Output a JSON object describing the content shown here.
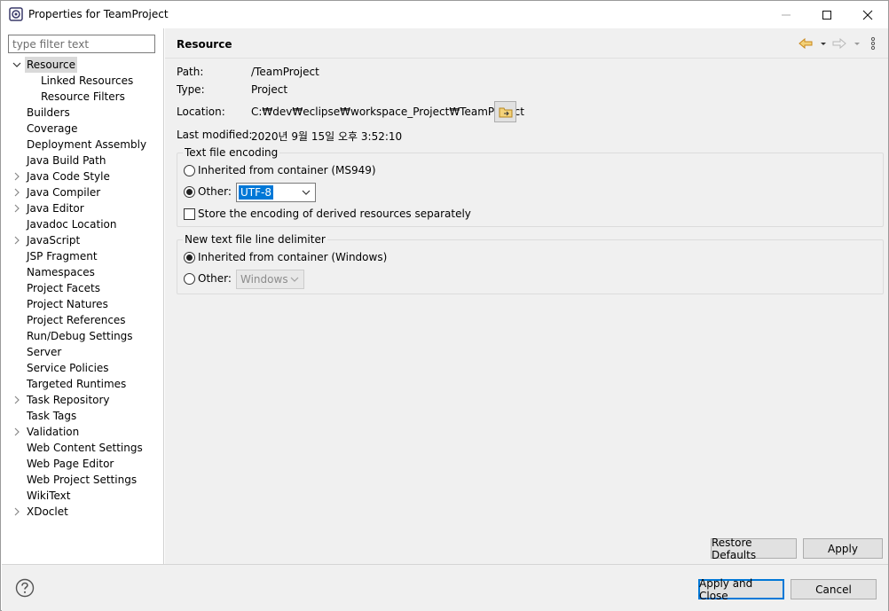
{
  "window": {
    "title": "Properties for TeamProject"
  },
  "filter": {
    "placeholder": "type filter text"
  },
  "tree": [
    {
      "label": "Resource",
      "level": 0,
      "expander": "expanded",
      "selected": true
    },
    {
      "label": "Linked Resources",
      "level": 1,
      "expander": "none"
    },
    {
      "label": "Resource Filters",
      "level": 1,
      "expander": "none"
    },
    {
      "label": "Builders",
      "level": 0,
      "expander": "none"
    },
    {
      "label": "Coverage",
      "level": 0,
      "expander": "none"
    },
    {
      "label": "Deployment Assembly",
      "level": 0,
      "expander": "none"
    },
    {
      "label": "Java Build Path",
      "level": 0,
      "expander": "none"
    },
    {
      "label": "Java Code Style",
      "level": 0,
      "expander": "collapsed"
    },
    {
      "label": "Java Compiler",
      "level": 0,
      "expander": "collapsed"
    },
    {
      "label": "Java Editor",
      "level": 0,
      "expander": "collapsed"
    },
    {
      "label": "Javadoc Location",
      "level": 0,
      "expander": "none"
    },
    {
      "label": "JavaScript",
      "level": 0,
      "expander": "collapsed"
    },
    {
      "label": "JSP Fragment",
      "level": 0,
      "expander": "none"
    },
    {
      "label": "Namespaces",
      "level": 0,
      "expander": "none"
    },
    {
      "label": "Project Facets",
      "level": 0,
      "expander": "none"
    },
    {
      "label": "Project Natures",
      "level": 0,
      "expander": "none"
    },
    {
      "label": "Project References",
      "level": 0,
      "expander": "none"
    },
    {
      "label": "Run/Debug Settings",
      "level": 0,
      "expander": "none"
    },
    {
      "label": "Server",
      "level": 0,
      "expander": "none"
    },
    {
      "label": "Service Policies",
      "level": 0,
      "expander": "none"
    },
    {
      "label": "Targeted Runtimes",
      "level": 0,
      "expander": "none"
    },
    {
      "label": "Task Repository",
      "level": 0,
      "expander": "collapsed"
    },
    {
      "label": "Task Tags",
      "level": 0,
      "expander": "none"
    },
    {
      "label": "Validation",
      "level": 0,
      "expander": "collapsed"
    },
    {
      "label": "Web Content Settings",
      "level": 0,
      "expander": "none"
    },
    {
      "label": "Web Page Editor",
      "level": 0,
      "expander": "none"
    },
    {
      "label": "Web Project Settings",
      "level": 0,
      "expander": "none"
    },
    {
      "label": "WikiText",
      "level": 0,
      "expander": "none"
    },
    {
      "label": "XDoclet",
      "level": 0,
      "expander": "collapsed"
    }
  ],
  "page": {
    "title": "Resource",
    "path_label": "Path:",
    "path_value": "/TeamProject",
    "type_label": "Type:",
    "type_value": "Project",
    "location_label": "Location:",
    "location_value": "C:₩dev₩eclipse₩workspace_Project₩TeamProject",
    "modified_label": "Last modified:",
    "modified_value": "2020년 9월 15일 오후 3:52:10"
  },
  "encoding": {
    "group_label": "Text file encoding",
    "inherited_label": "Inherited from container (MS949)",
    "other_label": "Other:",
    "other_value": "UTF-8",
    "store_label": "Store the encoding of derived resources separately"
  },
  "delimiter": {
    "group_label": "New text file line delimiter",
    "inherited_label": "Inherited from container (Windows)",
    "other_label": "Other:",
    "other_value": "Windows"
  },
  "buttons": {
    "restore_defaults": "Restore Defaults",
    "apply": "Apply",
    "apply_and_close": "Apply and Close",
    "cancel": "Cancel"
  },
  "icons": {
    "app": "eclipse-properties-icon",
    "back": "back-arrow-icon",
    "forward": "forward-arrow-icon",
    "menu": "view-menu-icon",
    "browse": "folder-browse-icon",
    "help": "help-icon"
  },
  "colors": {
    "accent": "#0078d7",
    "nav_arrow": "#e8a21a"
  }
}
